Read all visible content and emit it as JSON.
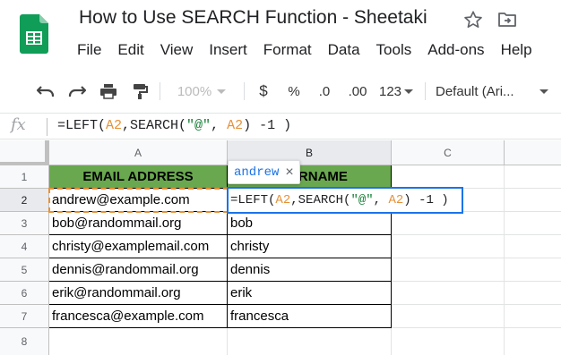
{
  "document": {
    "title": "How to Use SEARCH Function - Sheetaki"
  },
  "menu": [
    "File",
    "Edit",
    "View",
    "Insert",
    "Format",
    "Data",
    "Tools",
    "Add-ons",
    "Help"
  ],
  "toolbar": {
    "zoom": "100%",
    "currency": "$",
    "percent": "%",
    "decrease_decimal": ".0",
    "increase_decimal": ".00",
    "number_format": "123",
    "font": "Default (Ari..."
  },
  "formula_bar": {
    "fx_label": "fx",
    "formula_parts": [
      {
        "text": "=LEFT(",
        "kind": "plain"
      },
      {
        "text": "A2",
        "kind": "ref"
      },
      {
        "text": ",SEARCH(",
        "kind": "plain"
      },
      {
        "text": "\"@\"",
        "kind": "string"
      },
      {
        "text": ", ",
        "kind": "plain"
      },
      {
        "text": "A2",
        "kind": "ref"
      },
      {
        "text": ") -1 )",
        "kind": "plain"
      }
    ]
  },
  "grid": {
    "columns": [
      "A",
      "B",
      "C"
    ],
    "rows": [
      "1",
      "2",
      "3",
      "4",
      "5",
      "6",
      "7",
      "8"
    ],
    "header_row": {
      "A1": "EMAIL ADDRESS",
      "B1": "USERNAME"
    },
    "data_rows": [
      {
        "email": "andrew@example.com",
        "username": ""
      },
      {
        "email": "bob@randommail.org",
        "username": "bob"
      },
      {
        "email": "christy@examplemail.com",
        "username": "christy"
      },
      {
        "email": "dennis@randommail.org",
        "username": "dennis"
      },
      {
        "email": "erik@randommail.org",
        "username": "erik"
      },
      {
        "email": "francesca@example.com",
        "username": "francesca"
      }
    ],
    "active_cell": "B2",
    "preview_chip": {
      "value": "andrew",
      "close": "×"
    }
  },
  "colors": {
    "header_fill": "#6aa84f",
    "reference_color": "#e69138",
    "string_color": "#188038",
    "selection_blue": "#1a73e8",
    "logo_green": "#0f9d58"
  },
  "icons": [
    "sheets-logo-icon",
    "star-icon",
    "move-to-folder-icon",
    "undo-icon",
    "redo-icon",
    "print-icon",
    "paint-format-icon",
    "close-icon"
  ]
}
